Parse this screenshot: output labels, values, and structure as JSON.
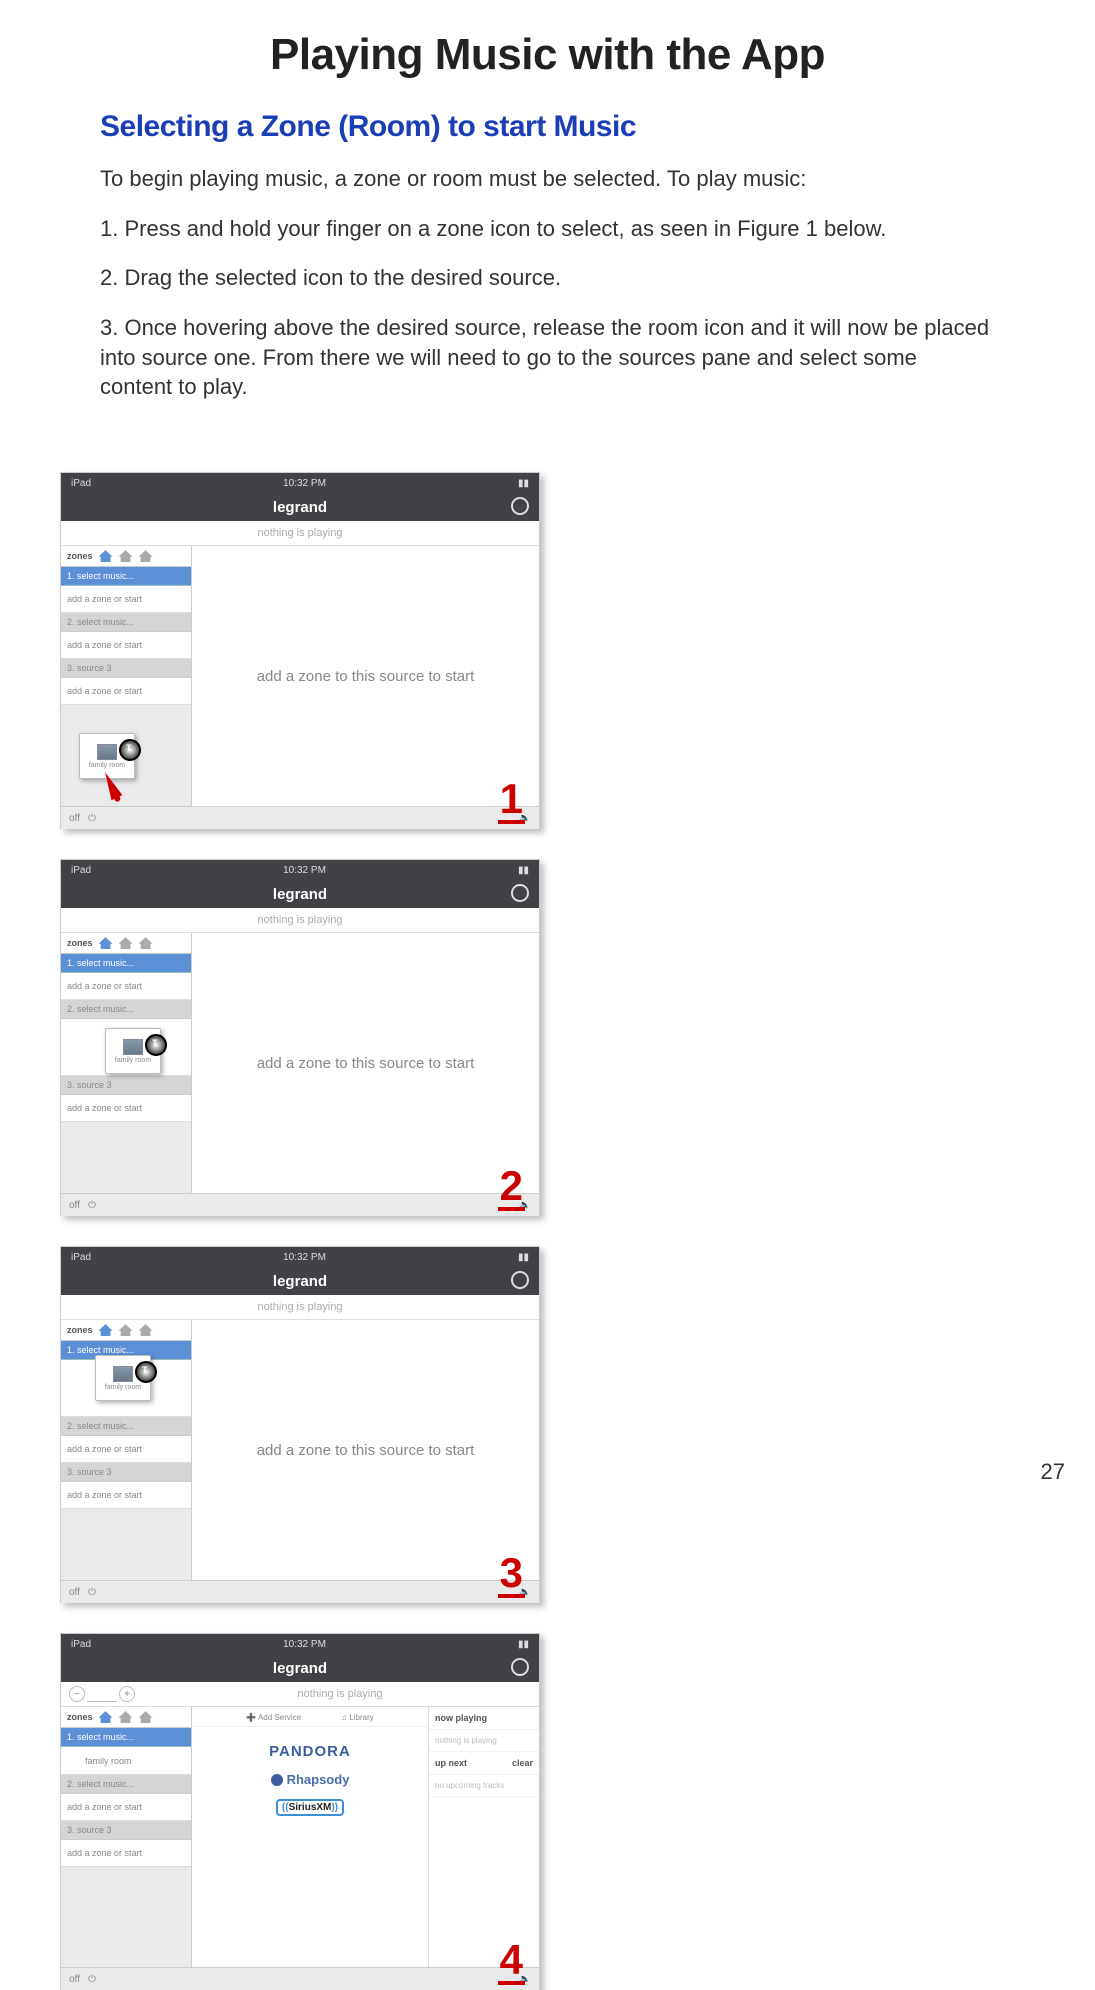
{
  "title": "Playing Music with the App",
  "section": "Selecting a Zone (Room) to start Music",
  "intro": "To begin playing music, a zone or room must be selected.  To play music:",
  "step1": "1. Press and hold your finger on a zone icon to select, as seen in Figure 1 below.",
  "step2": "2. Drag the selected icon to the desired source.",
  "step3": "3. Once hovering above the desired source, release the room icon and it will now be placed into source one.  From there we will need to go to the sources pane and select some content to play.",
  "page_number": "27",
  "fig_labels": [
    "1",
    "2",
    "3",
    "4"
  ],
  "shot": {
    "status_left": "iPad",
    "status_time": "10:32 PM",
    "brand": "legrand",
    "nothing_playing": "nothing is playing",
    "zones_label": "zones",
    "select_music_1": "1. select music...",
    "add_zone_start": "add a zone or start",
    "select_music_2": "2. select music...",
    "source_3": "3. source 3",
    "main_msg": "add a zone to this source to start",
    "off": "off",
    "family_room": "family room",
    "add_service": "Add Service",
    "library": "Library",
    "now_playing": "now playing",
    "np_empty": "nothing is playing",
    "up_next": "up next",
    "clear": "clear",
    "upcoming": "no upcoming tracks",
    "services": {
      "pandora": "PANDORA",
      "rhapsody": "Rhapsody",
      "siriusxm": "SiriusXM"
    }
  }
}
